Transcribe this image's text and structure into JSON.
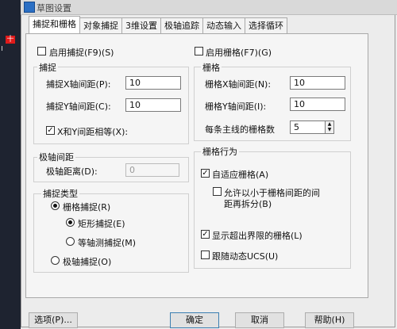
{
  "window": {
    "title": "草图设置"
  },
  "side": {
    "marker": "十"
  },
  "tabs": [
    "捕捉和栅格",
    "对象捕捉",
    "3维设置",
    "极轴追踪",
    "动态输入",
    "选择循环"
  ],
  "snap": {
    "enable_label": "启用捕捉(F9)(S)",
    "enabled": false,
    "group_title": "捕捉",
    "x_label": "捕捉X轴间距(P):",
    "x_value": "10",
    "y_label": "捕捉Y轴间距(C):",
    "y_value": "10",
    "equal_label": "X和Y间距相等(X):",
    "equal_checked": true
  },
  "polar": {
    "group_title": "极轴间距",
    "distance_label": "极轴距离(D):",
    "distance_value": "0"
  },
  "snap_type": {
    "group_title": "捕捉类型",
    "grid_snap": "栅格捕捉(R)",
    "rect_snap": "矩形捕捉(E)",
    "iso_snap": "等轴测捕捉(M)",
    "polar_snap": "极轴捕捉(O)",
    "selected_main": "grid",
    "selected_sub": "rect"
  },
  "grid": {
    "enable_label": "启用栅格(F7)(G)",
    "enabled": false,
    "group_title": "栅格",
    "x_label": "栅格X轴间距(N):",
    "x_value": "10",
    "y_label": "栅格Y轴间距(I):",
    "y_value": "10",
    "major_label": "每条主线的栅格数",
    "major_value": "5"
  },
  "grid_behavior": {
    "group_title": "栅格行为",
    "adaptive_label": "自适应栅格(A)",
    "adaptive_checked": true,
    "subdivide_label_line1": "允许以小于栅格间距的间",
    "subdivide_label_line2": "距再拆分(B)",
    "subdivide_checked": false,
    "beyond_label": "显示超出界限的栅格(L)",
    "beyond_checked": true,
    "follow_label": "跟随动态UCS(U)",
    "follow_checked": false
  },
  "buttons": {
    "options": "选项(P)...",
    "ok": "确定",
    "cancel": "取消",
    "help": "帮助(H)"
  }
}
